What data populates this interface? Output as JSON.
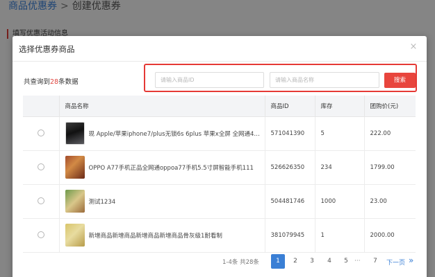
{
  "background": {
    "breadcrumb": {
      "parent": "商品优惠券",
      "separator": ">",
      "current": "创建优惠券"
    },
    "section_title": "填写优惠活动信息"
  },
  "modal": {
    "title": "选择优惠券商品",
    "close_icon": "×",
    "count": {
      "prefix": "共查询到",
      "value": "28",
      "suffix": "条数据"
    },
    "search": {
      "id_placeholder": "请输入商品ID",
      "name_placeholder": "请输入商品名称",
      "button_label": "搜索"
    },
    "table": {
      "headers": [
        "",
        "商品名称",
        "商品ID",
        "库存",
        "团购价(元)"
      ],
      "rows": [
        {
          "thumb": "phone-thumbnail",
          "name": "现 Apple/苹果iphone7/plus无锁6s 6plus 苹果x全屏 全网通4…",
          "id": "571041390",
          "stock": "5",
          "price": "222.00"
        },
        {
          "thumb": "oppo-thumbnail",
          "name": "OPPO A77手机正品全网通oppoa77手机5.5寸屏智能手机111",
          "id": "526626350",
          "stock": "234",
          "price": "1799.00"
        },
        {
          "thumb": "test-thumbnail",
          "name": "测试1234",
          "id": "504481746",
          "stock": "1000",
          "price": "23.00"
        },
        {
          "thumb": "new-product-thumbnail",
          "name": "新增商品新增商品新增商品新增商品骨灰级1耐看制",
          "id": "381079945",
          "stock": "1",
          "price": "2000.00"
        }
      ]
    },
    "pagination": {
      "info": "1-4条 共28条",
      "pages": [
        "1",
        "2",
        "3",
        "4",
        "5"
      ],
      "active_page": "1",
      "ellipsis": "···",
      "last_page": "7",
      "next_label": "下一页",
      "next_icon": "»"
    }
  },
  "colors": {
    "accent_blue": "#3a7fd5",
    "search_red": "#e8453d",
    "highlight_border": "#e53935"
  }
}
